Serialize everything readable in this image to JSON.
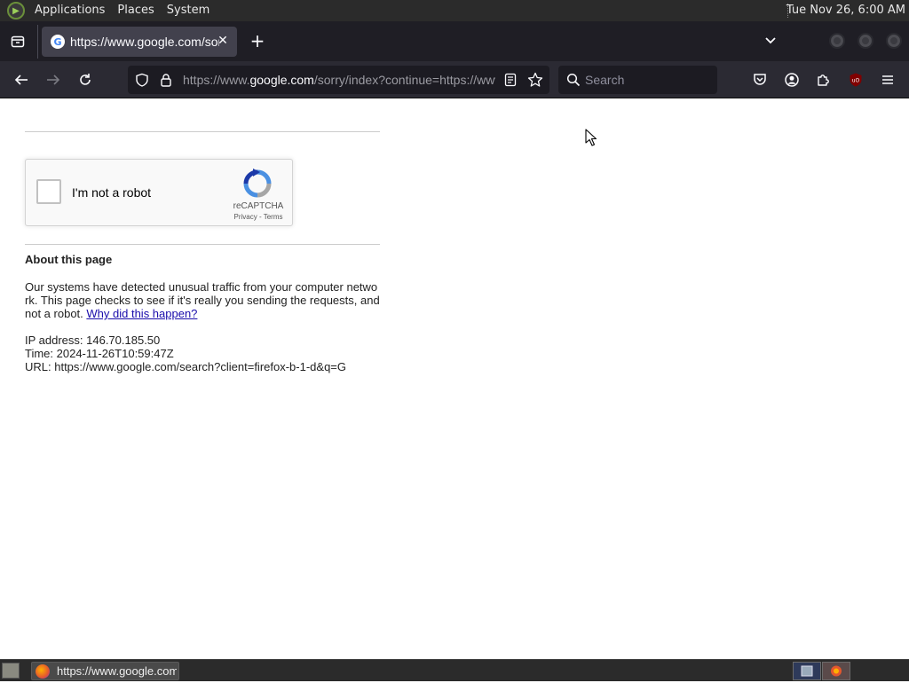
{
  "desktop": {
    "menus": [
      "Applications",
      "Places",
      "System"
    ],
    "clock": "Tue Nov 26,  6:00 AM"
  },
  "browser": {
    "tab": {
      "title": "https://www.google.com/sorry/index?continue=https://www.google.com/search",
      "favicon": "google-icon"
    },
    "url": {
      "prefix": "https://www.",
      "host": "google.com",
      "path": "/sorry/index?continue=https://www.google.com/search"
    },
    "search": {
      "placeholder": "Search"
    }
  },
  "page": {
    "recaptcha": {
      "label": "I'm not a robot",
      "brand": "reCAPTCHA",
      "privacy": "Privacy",
      "separator": " - ",
      "terms": "Terms"
    },
    "about": {
      "heading": "About this page",
      "body": "Our systems have detected unusual traffic from your computer network. This page checks to see if it's really you sending the requests, and not a robot. ",
      "link": "Why did this happen?",
      "ip": "IP address: 146.70.185.50",
      "time": "Time: 2024-11-26T10:59:47Z",
      "url": "URL: https://www.google.com/search?client=firefox-b-1-d&q=G"
    }
  },
  "taskbar": {
    "task_label": "https://www.google.com/sorry/index"
  },
  "colors": {
    "tabstrip": "#1f1e25",
    "toolbar": "#2b2a33",
    "link": "#1a0dab",
    "ublock": "#800000"
  }
}
